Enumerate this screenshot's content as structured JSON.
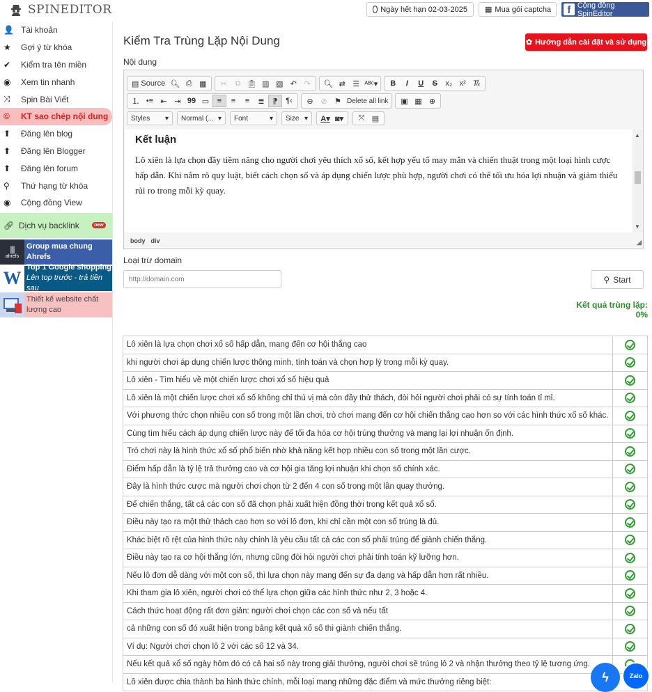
{
  "app": {
    "logo_text": "SPINEDITOR"
  },
  "topbar": {
    "expiry": "Ngày hết hạn 02-03-2025",
    "captcha": "Mua gói captcha",
    "community": "Cộng đồng SpinEditor"
  },
  "sidebar": {
    "items": [
      {
        "label": "Tài khoản",
        "icon": "user-icon"
      },
      {
        "label": "Gợi ý từ khóa",
        "icon": "star-icon"
      },
      {
        "label": "Kiểm tra tên miền",
        "icon": "check-icon"
      },
      {
        "label": "Xem tin nhanh",
        "icon": "eye-icon"
      },
      {
        "label": "Spin Bài Viết",
        "icon": "shuffle-icon"
      },
      {
        "label": "KT sao chép nội dung",
        "icon": "copyright-icon",
        "active": true
      },
      {
        "label": "Đăng lên blog",
        "icon": "upload-icon"
      },
      {
        "label": "Đăng lên Blogger",
        "icon": "upload-icon"
      },
      {
        "label": "Đăng lên forum",
        "icon": "upload-icon"
      },
      {
        "label": "Thứ hạng từ khóa",
        "icon": "search-icon"
      },
      {
        "label": "Cộng đồng View",
        "icon": "eye-icon"
      }
    ],
    "backlink": {
      "label": "Dịch vụ backlink",
      "badge": "new"
    },
    "promos": [
      {
        "line1": "Group mua chung Ahrefs",
        "line2": "",
        "logo": "ahrefs"
      },
      {
        "line1": "Top 1 Google shopping",
        "line2": "Lên top trước - trả tiền sau",
        "logo": "W"
      },
      {
        "line1": "Thiết kế website chất",
        "line2": "lượng cao",
        "logo": "web"
      }
    ]
  },
  "main": {
    "title": "Kiểm Tra Trùng Lặp Nội Dung",
    "guide_button": "Hướng dẫn cài đặt và sử dụng",
    "content_label": "Nội dung",
    "exclude_label": "Loại trừ domain",
    "domain_placeholder": "http://domain.com",
    "start_button": "Start",
    "result_text": "Kết quả trùng lặp: 0%"
  },
  "editor": {
    "source_label": "Source",
    "delete_links_label": "Delete all link",
    "styles_label": "Styles",
    "format_label": "Normal (...",
    "font_label": "Font",
    "size_label": "Size",
    "heading": "Kết luận",
    "paragraph": "Lô xiên là lựa chọn đầy tiềm năng cho người chơi yêu thích xổ số, kết hợp yếu tố may mắn và chiến thuật trong một loại hình cược hấp dẫn. Khi nắm rõ quy luật, biết cách chọn số và áp dụng chiến lược phù hợp, người chơi có thể tối ưu hóa lợi nhuận và giảm thiểu rủi ro trong mỗi kỳ quay.",
    "path": [
      "body",
      "div"
    ]
  },
  "results": [
    "Lô xiên là lựa chọn chơi xổ số hấp dẫn, mang đến cơ hội thắng cao",
    "khi người chơi áp dụng chiến lược thông minh, tính toán và chọn hợp lý trong mỗi kỳ quay.",
    "Lô xiên - Tìm hiểu về một chiến lược chơi xổ số hiệu quả",
    "Lô xiên là một chiến lược chơi xổ số không chỉ thú vị mà còn đầy thử thách, đòi hỏi người chơi phải có sự tính toán tỉ mỉ.",
    "Với phương thức chọn nhiều con số trong một lần chơi, trò chơi mang đến cơ hội chiến thắng cao hơn so với các hình thức xổ số khác.",
    "Cùng tìm hiểu cách áp dụng chiến lược này để tối đa hóa cơ hội trúng thưởng và mang lại lợi nhuận ổn định.",
    "Trò chơi này là hình thức xổ số phổ biến nhờ khả năng kết hợp nhiều con số trong một lần cược.",
    "Điểm hấp dẫn là tỷ lệ trả thưởng cao và cơ hội gia tăng lợi nhuận khi chọn số chính xác.",
    "Đây là hình thức cược mà người chơi chọn từ 2 đến 4 con số trong một lần quay thưởng.",
    "Để chiến thắng, tất cả các con số đã chọn phải xuất hiện đồng thời trong kết quả xổ số.",
    "Điều này tạo ra một thử thách cao hơn so với lô đơn, khi chỉ cần một con số trúng là đủ.",
    "Khác biệt rõ rệt của hình thức này chính là yêu cầu tất cả các con số phải trúng để giành chiến thắng.",
    "Điều này tạo ra cơ hội thắng lớn, nhưng cũng đòi hỏi người chơi phải tính toán kỹ lưỡng hơn.",
    "Nếu lô đơn dễ dàng với một con số, thì lựa chọn này mang đến sự đa dạng và hấp dẫn hơn rất nhiều.",
    "Khi tham gia lô xiên, người chơi có thể lựa chọn giữa các hình thức như 2, 3 hoặc 4.",
    "Cách thức hoạt động rất đơn giản: người chơi chọn các con số và nếu tất",
    "cả những con số đó xuất hiện trong bảng kết quả xổ số thì giành chiến thắng.",
    "Ví dụ: Người chơi chọn lô 2 với các số 12 và 34.",
    "Nếu kết quả xổ số ngày hôm đó có cả hai số này trong giải thưởng, người chơi sẽ trúng lô 2 và nhận thưởng theo tỷ lệ tương ứng.",
    "Lô xiên được chia thành ba hình thức chính, mỗi loại mang những đặc điểm và mức thưởng riêng biệt:"
  ],
  "chat": {
    "zalo": "Zalo"
  },
  "colors": {
    "accent_red": "#e5131b",
    "result_green": "#2e8b2e",
    "fb_blue": "#3b5998",
    "active_bg": "#f8bdbd"
  }
}
